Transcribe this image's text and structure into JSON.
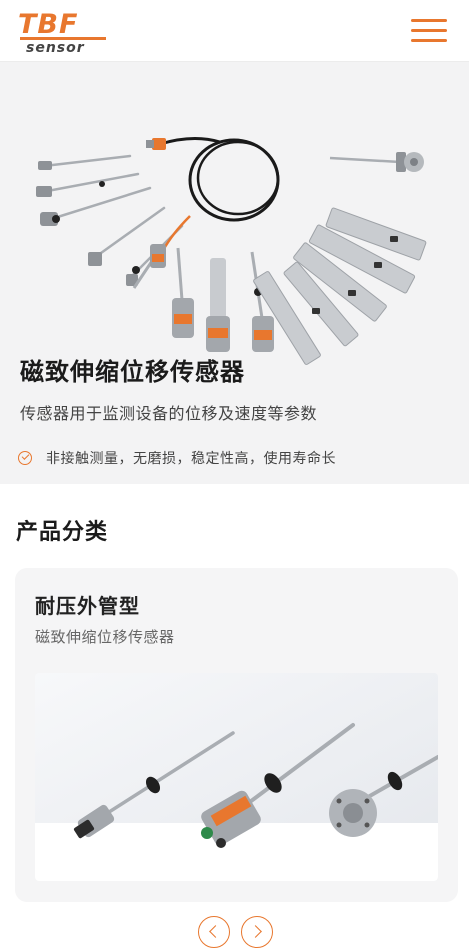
{
  "header": {
    "logo_main": "TBF",
    "logo_sub": "sensor",
    "menu_icon": "hamburger-menu-icon"
  },
  "hero": {
    "title": "磁致伸缩位移传感器",
    "description": "传感器用于监测设备的位移及速度等参数",
    "feature_icon": "check-circle-icon",
    "feature": "非接触测量，无磨损，稳定性高，使用寿命长"
  },
  "categories": {
    "section_title": "产品分类",
    "card": {
      "title": "耐压外管型",
      "subtitle": "磁致伸缩位移传感器"
    }
  },
  "pager": {
    "prev_icon": "chevron-left-icon",
    "next_icon": "chevron-right-icon"
  },
  "colors": {
    "accent": "#e8772e",
    "hero_bg": "#f3f3f4",
    "card_bg": "#f5f5f6"
  }
}
